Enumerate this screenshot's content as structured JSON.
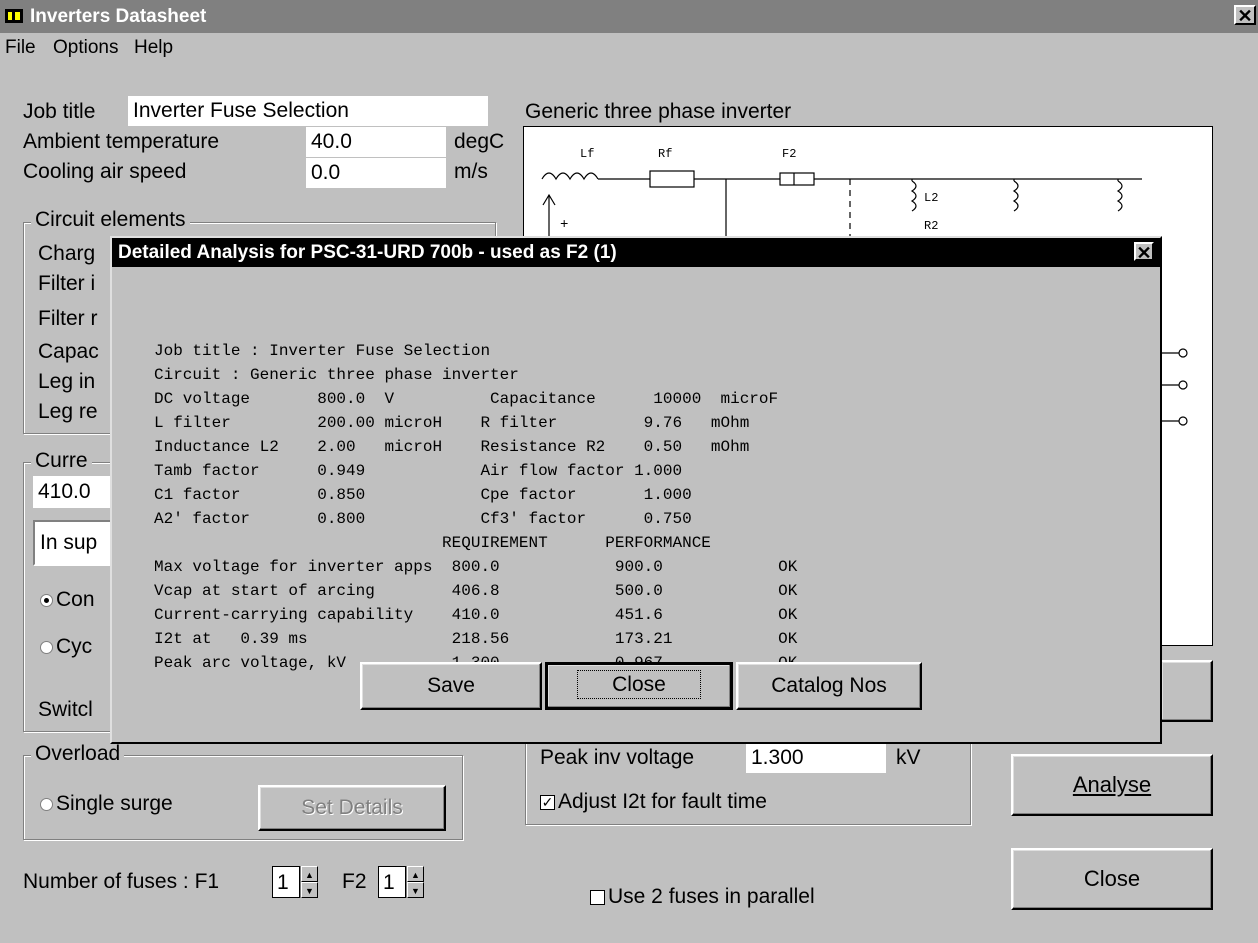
{
  "window": {
    "title": "Inverters Datasheet"
  },
  "menu": [
    "File",
    "Options",
    "Help"
  ],
  "job": {
    "title_label": "Job title",
    "title_value": "Inverter Fuse Selection",
    "ambient_label": "Ambient temperature",
    "ambient_value": "40.0",
    "ambient_unit": "degC",
    "air_label": "Cooling air speed",
    "air_value": "0.0",
    "air_unit": "m/s"
  },
  "circuit_elements": {
    "title": "Circuit elements",
    "rows": [
      "Charg",
      "Filter i",
      "Filter r",
      "Capac",
      "Leg in",
      "Leg re"
    ]
  },
  "current": {
    "title": "Curre",
    "value": "410.0",
    "combo": "In sup",
    "radio1": "Con",
    "radio2": "Cyc",
    "switch": "Switcl"
  },
  "overload": {
    "title": "Overload",
    "radio": "Single surge",
    "button": "Set Details"
  },
  "fuses": {
    "label": "Number of fuses : F1",
    "f1": "1",
    "f2_label": "F2",
    "f2": "1"
  },
  "diagram": {
    "title": "Generic three phase inverter",
    "labels": {
      "lf": "Lf",
      "rf": "Rf",
      "f2": "F2",
      "l2": "L2",
      "r2": "R2",
      "plus": "+"
    }
  },
  "peak": {
    "label": "Peak inv voltage",
    "value": "1.300",
    "unit": "kV",
    "adjust_label": "Adjust I2t for fault time"
  },
  "parallel_label": "Use 2 fuses in parallel",
  "buttons": {
    "analyse": "Analyse",
    "close": "Close"
  },
  "dialog": {
    "title": "Detailed Analysis for PSC-31-URD 700b - used as F2 (1)",
    "report_lines": [
      "Job title : Inverter Fuse Selection",
      "Circuit : Generic three phase inverter",
      "DC voltage       800.0  V          Capacitance      10000  microF",
      "L filter         200.00 microH    R filter         9.76   mOhm",
      "Inductance L2    2.00   microH    Resistance R2    0.50   mOhm",
      "Tamb factor      0.949            Air flow factor 1.000",
      "C1 factor        0.850            Cpe factor       1.000",
      "A2' factor       0.800            Cf3' factor      0.750",
      "                              REQUIREMENT      PERFORMANCE",
      "Max voltage for inverter apps  800.0            900.0            OK",
      "Vcap at start of arcing        406.8            500.0            OK",
      "Current-carrying capability    410.0            451.6            OK",
      "I2t at   0.39 ms               218.56           173.21           OK",
      "Peak arc voltage, kV           1.300            0.967            OK"
    ],
    "buttons": {
      "save": "Save",
      "close": "Close",
      "catalog": "Catalog Nos"
    }
  }
}
